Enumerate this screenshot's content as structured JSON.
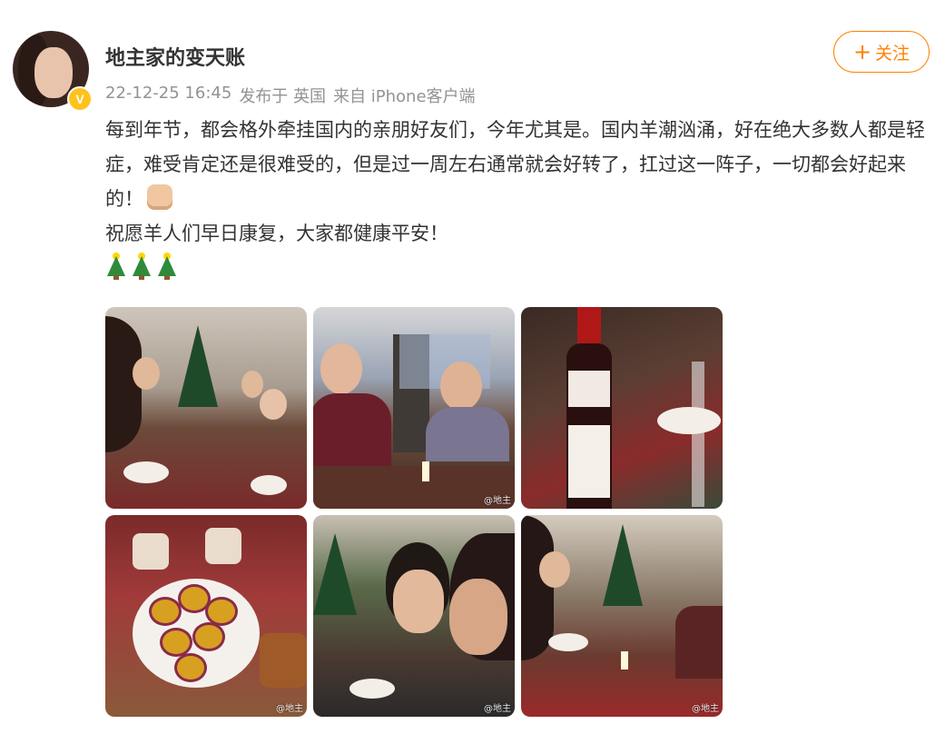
{
  "user": {
    "name": "地主家的变天账",
    "verified_badge": "V"
  },
  "meta": {
    "date": "22-12-25 16:45",
    "location": "发布于 英国",
    "source": "来自 iPhone客户端"
  },
  "follow": {
    "plus": "+",
    "label": "关注"
  },
  "post": {
    "line1": "每到年节，都会格外牵挂国内的亲朋好友们，今年尤其是。国内羊潮汹涌，好在绝大多数人都是轻症，难受肯定还是很难受的，但是过一周左右通常就会好转了，扛过这一阵子，一切都会好起来的！",
    "line2": "祝愿羊人们早日康复，大家都健康平安！"
  },
  "photos": [
    {
      "watermark": ""
    },
    {
      "watermark": "@地主"
    },
    {
      "watermark": ""
    },
    {
      "watermark": "@地主"
    },
    {
      "watermark": "@地主"
    },
    {
      "watermark": "@地主"
    }
  ],
  "colors": {
    "accent": "#ff8200",
    "meta_text": "#939393",
    "badge": "#ffc21d"
  }
}
